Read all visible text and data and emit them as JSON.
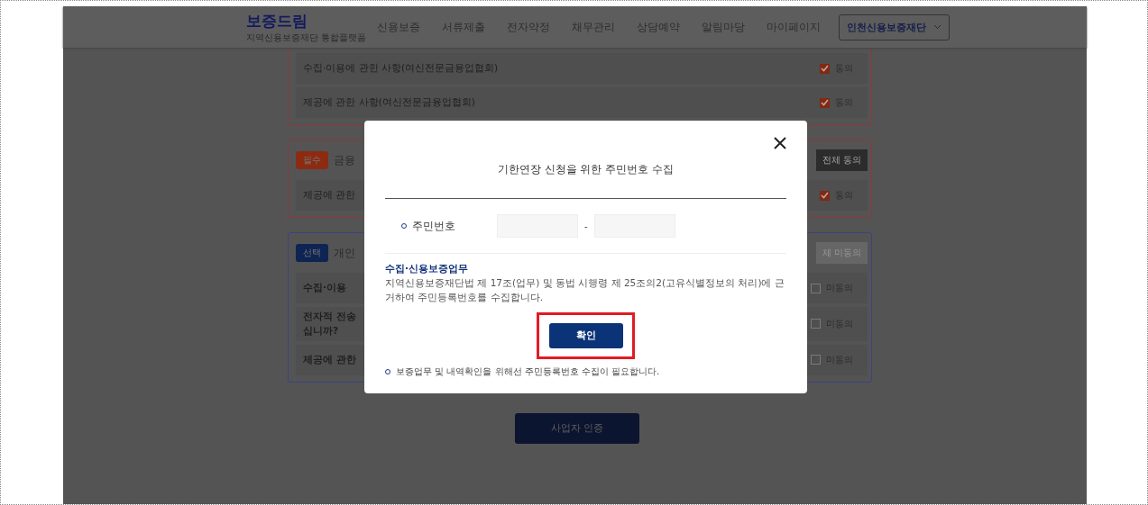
{
  "header": {
    "logo": "보증드림",
    "logo_sub": "지역신용보증재단 통합플랫폼",
    "nav": [
      "신용보증",
      "서류제출",
      "전자약정",
      "채무관리",
      "상담예약",
      "알림마당",
      "마이페이지"
    ],
    "org_select": "인천신용보증재단"
  },
  "sections": [
    {
      "kind": "required",
      "rows": [
        {
          "label": "수집·이용에 관한 사항(여신전문금융업협회)",
          "checked": true,
          "check_label": "동의"
        },
        {
          "label": "제공에 관한 사항(여신전문금융업협회)",
          "checked": true,
          "check_label": "동의"
        }
      ]
    },
    {
      "kind": "required",
      "badge": {
        "text": "필수",
        "color": "#8c2b12"
      },
      "title": "금융",
      "all_button": "전체 동의",
      "rows": [
        {
          "label": "제공에 관한",
          "checked": true,
          "check_label": "동의"
        }
      ]
    },
    {
      "kind": "optional",
      "badge": {
        "text": "선택",
        "color": "#0e2452"
      },
      "title": "개인",
      "all_button": "체 미동의",
      "rows": [
        {
          "label": "수집·이용",
          "checked": false,
          "check_label": "미동의"
        },
        {
          "label": "전자적 전송\n십니까?",
          "checked": false,
          "check_label": "미동의"
        },
        {
          "label": "제공에 관한",
          "checked": false,
          "check_label": "미동의"
        }
      ]
    }
  ],
  "submit_button": "사업자 인증",
  "modal": {
    "title": "기한연장 신청을 위한 주민번호 수집",
    "field_label": "주민번호",
    "separator": "-",
    "info_title": "수집·신용보증업무",
    "info_text": "지역신용보증재단법 제 17조(업무) 및 동법 시행령 제 25조의2(고유식별정보의 처리)에 근거하여 주민등록번호를 수집합니다.",
    "confirm_button": "확인",
    "confirm_highlighted": true,
    "note": "보증업무 및 내역확인을 위해선 주민등록번호 수집이 필요합니다."
  }
}
